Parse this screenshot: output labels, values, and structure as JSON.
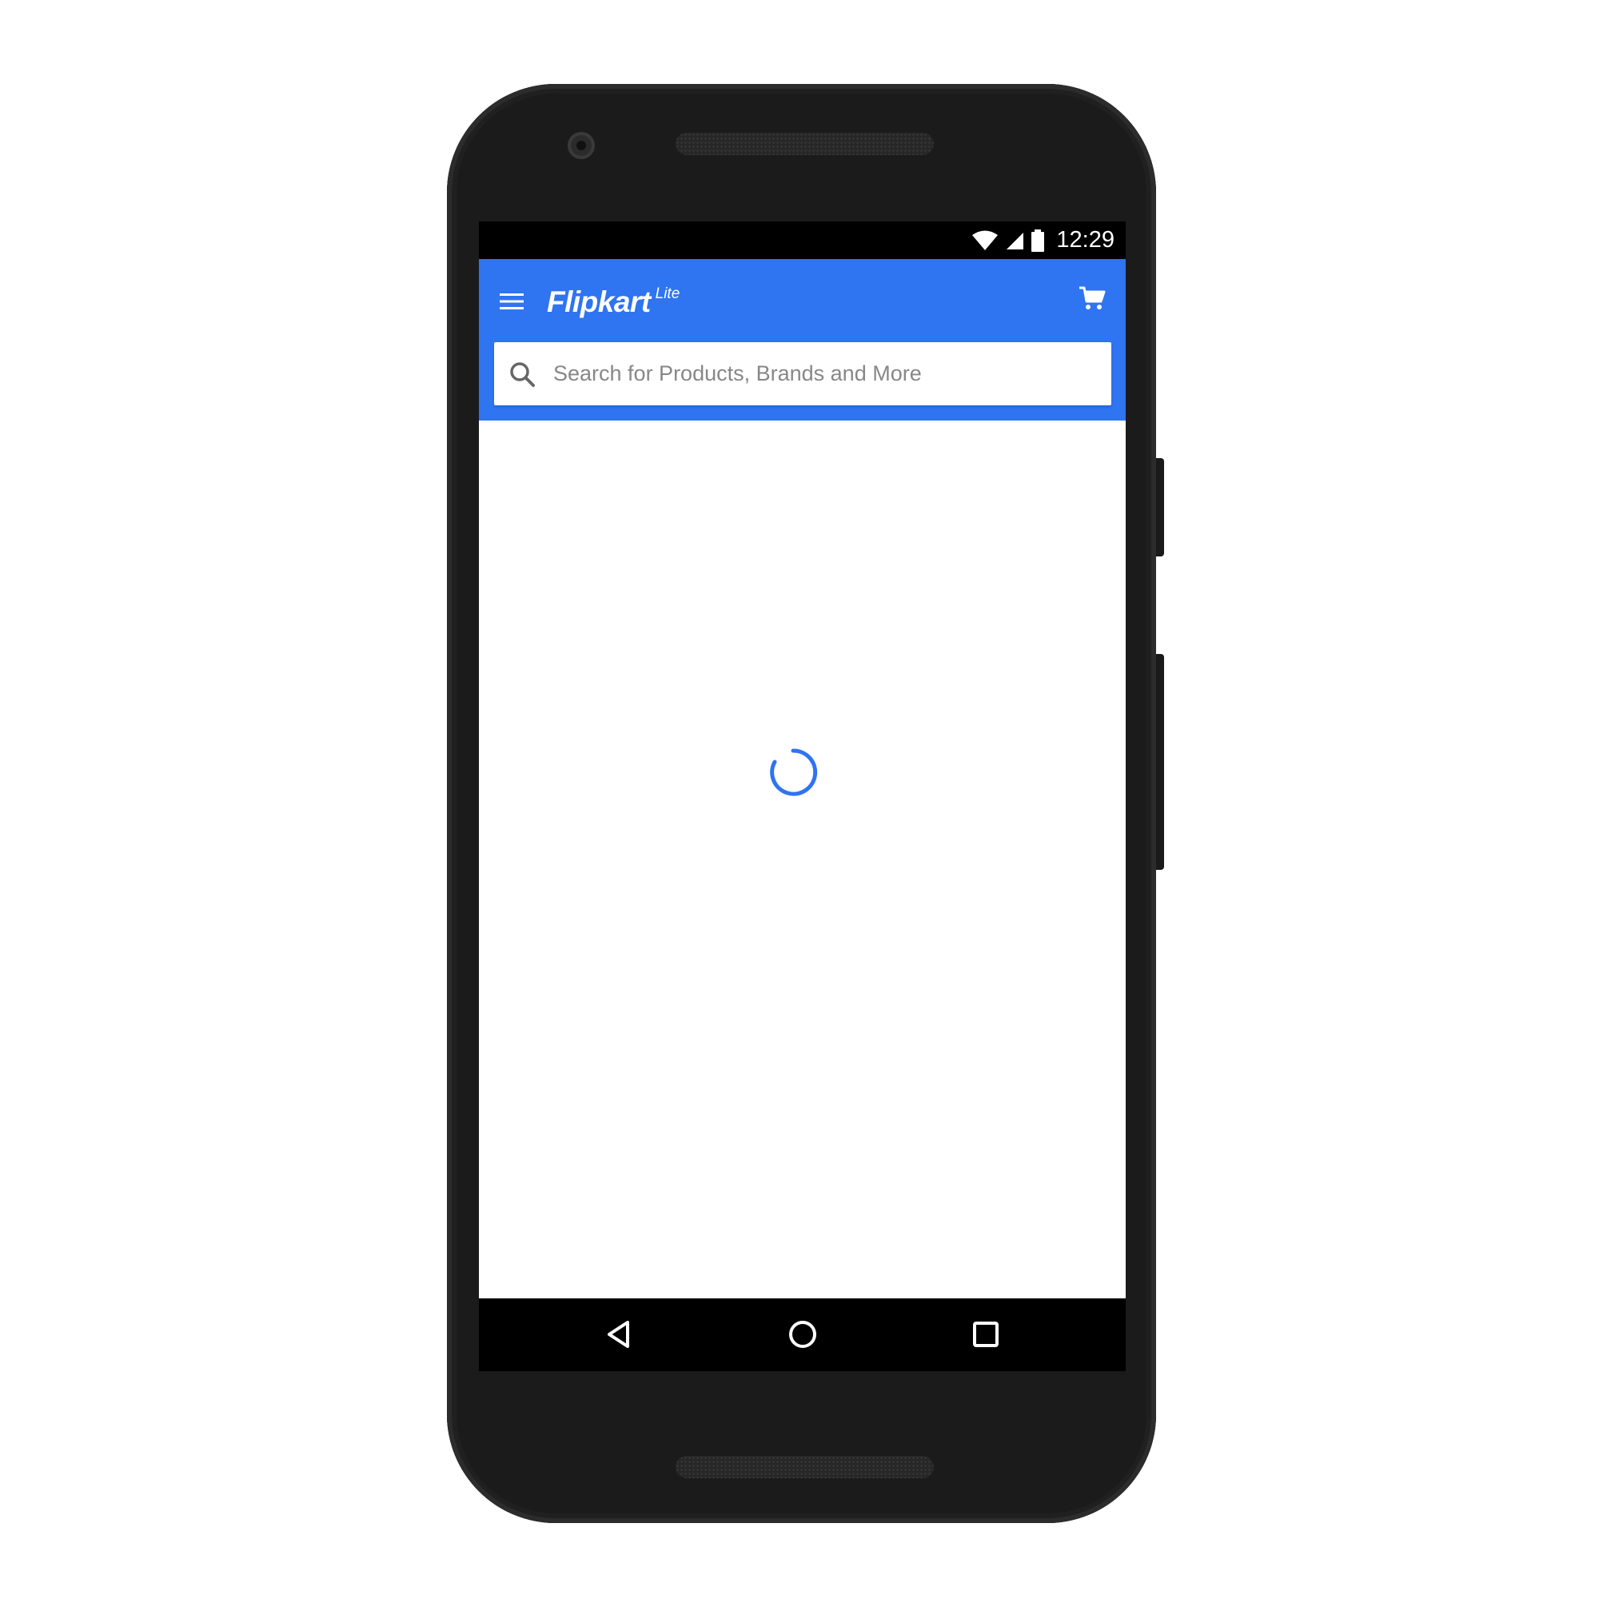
{
  "status_bar": {
    "time": "12:29",
    "icons": [
      "wifi-icon",
      "cellular-signal-icon",
      "battery-icon"
    ]
  },
  "header": {
    "menu_icon": "hamburger-menu-icon",
    "logo_text": "Flipkart",
    "logo_superscript": "Lite",
    "cart_icon": "shopping-cart-icon"
  },
  "search": {
    "placeholder": "Search for Products, Brands and More",
    "value": "",
    "icon": "search-icon"
  },
  "content": {
    "state": "loading",
    "spinner_icon": "loading-spinner-icon"
  },
  "navigation": {
    "back_icon": "back-triangle-icon",
    "home_icon": "home-circle-icon",
    "recents_icon": "recents-square-icon"
  },
  "colors": {
    "brand_blue": "#2f74f0",
    "status_bar": "#000000",
    "nav_bar": "#000000",
    "phone_body": "#1b1b1b",
    "placeholder_text": "#878787"
  }
}
